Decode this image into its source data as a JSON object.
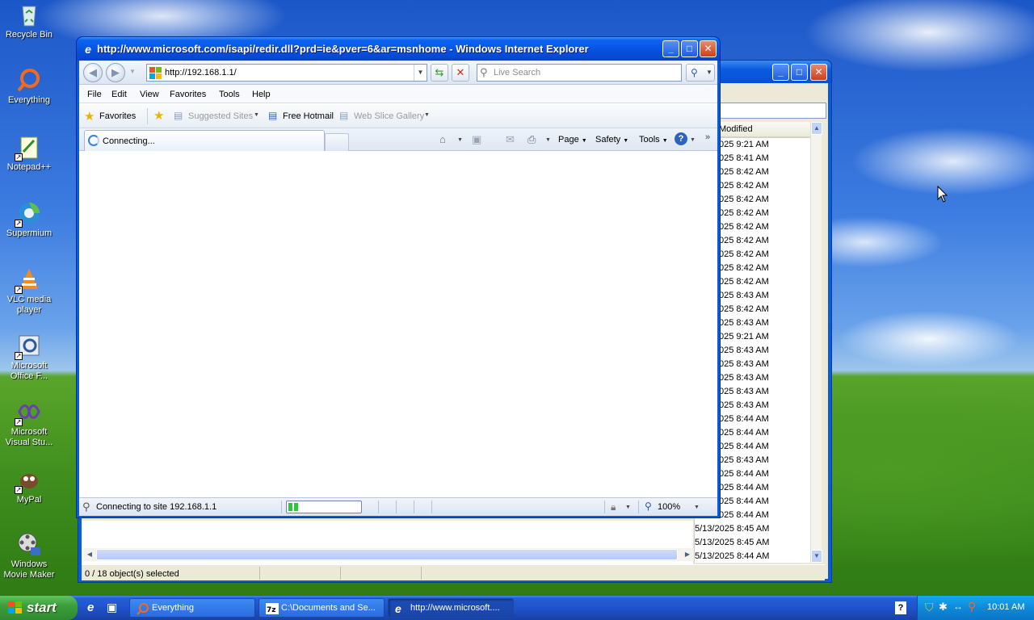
{
  "desktop": {
    "icons": [
      {
        "label": "Recycle Bin",
        "icon": "recycle-bin-icon"
      },
      {
        "label": "Everything",
        "icon": "everything-search-icon"
      },
      {
        "label": "Notepad++",
        "icon": "notepadpp-icon"
      },
      {
        "label": "Supermium",
        "icon": "supermium-browser-icon"
      },
      {
        "label": "VLC media player",
        "icon": "vlc-icon"
      },
      {
        "label": "Microsoft Office F...",
        "icon": "office-icon"
      },
      {
        "label": "Microsoft Visual Stu...",
        "icon": "visual-studio-icon"
      },
      {
        "label": "MyPal",
        "icon": "mypal-browser-icon"
      },
      {
        "label": "Windows Movie Maker",
        "icon": "movie-maker-icon"
      }
    ]
  },
  "explorer": {
    "column_header": "Modified",
    "rows": [
      "025 9:21 AM",
      "025 8:41 AM",
      "025 8:42 AM",
      "025 8:42 AM",
      "025 8:42 AM",
      "025 8:42 AM",
      "025 8:42 AM",
      "025 8:42 AM",
      "025 8:42 AM",
      "025 8:42 AM",
      "025 8:42 AM",
      "025 8:43 AM",
      "025 8:42 AM",
      "025 8:43 AM",
      "025 9:21 AM",
      "025 8:43 AM",
      "025 8:43 AM",
      "025 8:43 AM",
      "025 8:43 AM",
      "025 8:43 AM",
      "025 8:44 AM",
      "025 8:44 AM",
      "025 8:44 AM",
      "025 8:43 AM",
      "025 8:44 AM",
      "025 8:44 AM",
      "025 8:44 AM",
      "025 8:44 AM",
      "5/13/2025 8:45 AM",
      "5/13/2025 8:45 AM",
      "5/13/2025 8:44 AM"
    ],
    "status": "0 / 18 object(s) selected"
  },
  "ie": {
    "title": "http://www.microsoft.com/isapi/redir.dll?prd=ie&pver=6&ar=msnhome - Windows Internet Explorer",
    "address": "http://192.168.1.1/",
    "search_placeholder": "Live Search",
    "menu": [
      "File",
      "Edit",
      "View",
      "Favorites",
      "Tools",
      "Help"
    ],
    "favorites_bar": {
      "favorites": "Favorites",
      "suggested_sites": "Suggested Sites",
      "free_hotmail": "Free Hotmail",
      "web_slice_gallery": "Web Slice Gallery"
    },
    "tab_label": "Connecting...",
    "command_bar": {
      "page": "Page",
      "safety": "Safety",
      "tools": "Tools"
    },
    "status": {
      "text": "Connecting to site 192.168.1.1",
      "progress": 0.15,
      "zoom": "100%"
    }
  },
  "taskbar": {
    "start": "start",
    "buttons": [
      {
        "label": "Everything",
        "icon": "everything-search-icon"
      },
      {
        "label": "C:\\Documents and Se...",
        "icon": "7zip-icon"
      },
      {
        "label": "http://www.microsoft....",
        "icon": "ie-icon",
        "active": true
      }
    ],
    "clock": "10:01 AM"
  }
}
